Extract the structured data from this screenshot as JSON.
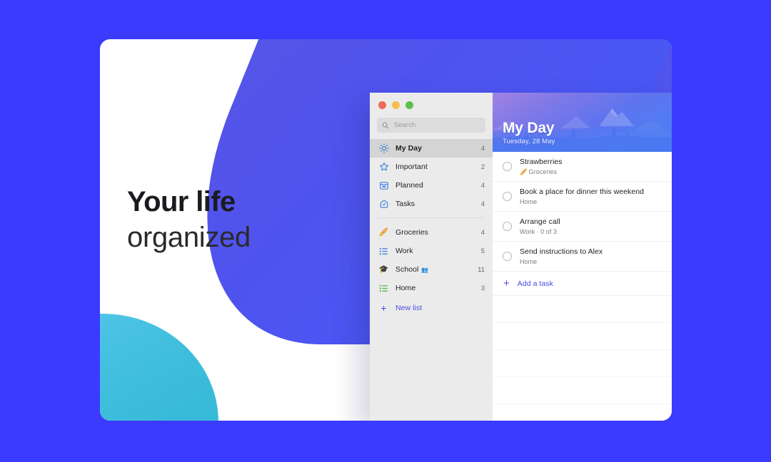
{
  "theme": {
    "background_blue": "#3b3bfe",
    "accent_indigo": "#4a4ae6",
    "teal_blob": "#3cbdda",
    "card_white": "#ffffff"
  },
  "hero": {
    "headline_line1": "Your life",
    "headline_line2": "organized"
  },
  "app_window": {
    "traffic_lights": [
      {
        "name": "close",
        "color": "#f1695c"
      },
      {
        "name": "minimize",
        "color": "#f6be4f"
      },
      {
        "name": "zoom",
        "color": "#5bc14c"
      }
    ],
    "search": {
      "placeholder": "Search",
      "value": "",
      "icon": "search-icon"
    },
    "sidebar": {
      "smart_lists": [
        {
          "label": "My Day",
          "count": "4",
          "icon": "sun-icon",
          "active": true
        },
        {
          "label": "Important",
          "count": "2",
          "icon": "star-icon",
          "active": false
        },
        {
          "label": "Planned",
          "count": "4",
          "icon": "calendar-icon",
          "active": false
        },
        {
          "label": "Tasks",
          "count": "4",
          "icon": "house-check-icon",
          "active": false
        }
      ],
      "custom_lists": [
        {
          "label": "Groceries",
          "count": "4",
          "icon": "baguette-emoji",
          "emoji": "🥖",
          "shared": ""
        },
        {
          "label": "Work",
          "count": "5",
          "icon": "blue-list-icon",
          "emoji": "",
          "shared": ""
        },
        {
          "label": "School",
          "count": "11",
          "icon": "graduation-cap-emoji",
          "emoji": "🎓",
          "shared": "👥"
        },
        {
          "label": "Home",
          "count": "3",
          "icon": "green-list-icon",
          "emoji": "",
          "shared": ""
        }
      ],
      "new_list_label": "New list"
    },
    "detail": {
      "header": {
        "title": "My Day",
        "date": "Tuesday, 28 May",
        "background": "mountain-landscape-gradient"
      },
      "tasks": [
        {
          "title": "Strawberries",
          "meta": "Groceries",
          "meta_emoji": "🥖",
          "checked": false
        },
        {
          "title": "Book a place for dinner this weekend",
          "meta": "Home",
          "meta_emoji": "",
          "checked": false
        },
        {
          "title": "Arrange call",
          "meta": "Work · 0 of 3",
          "meta_emoji": "",
          "checked": false
        },
        {
          "title": "Send instructions to Alex",
          "meta": "Home",
          "meta_emoji": "",
          "checked": false
        }
      ],
      "add_task_label": "Add a task",
      "empty_rows": 5
    }
  }
}
